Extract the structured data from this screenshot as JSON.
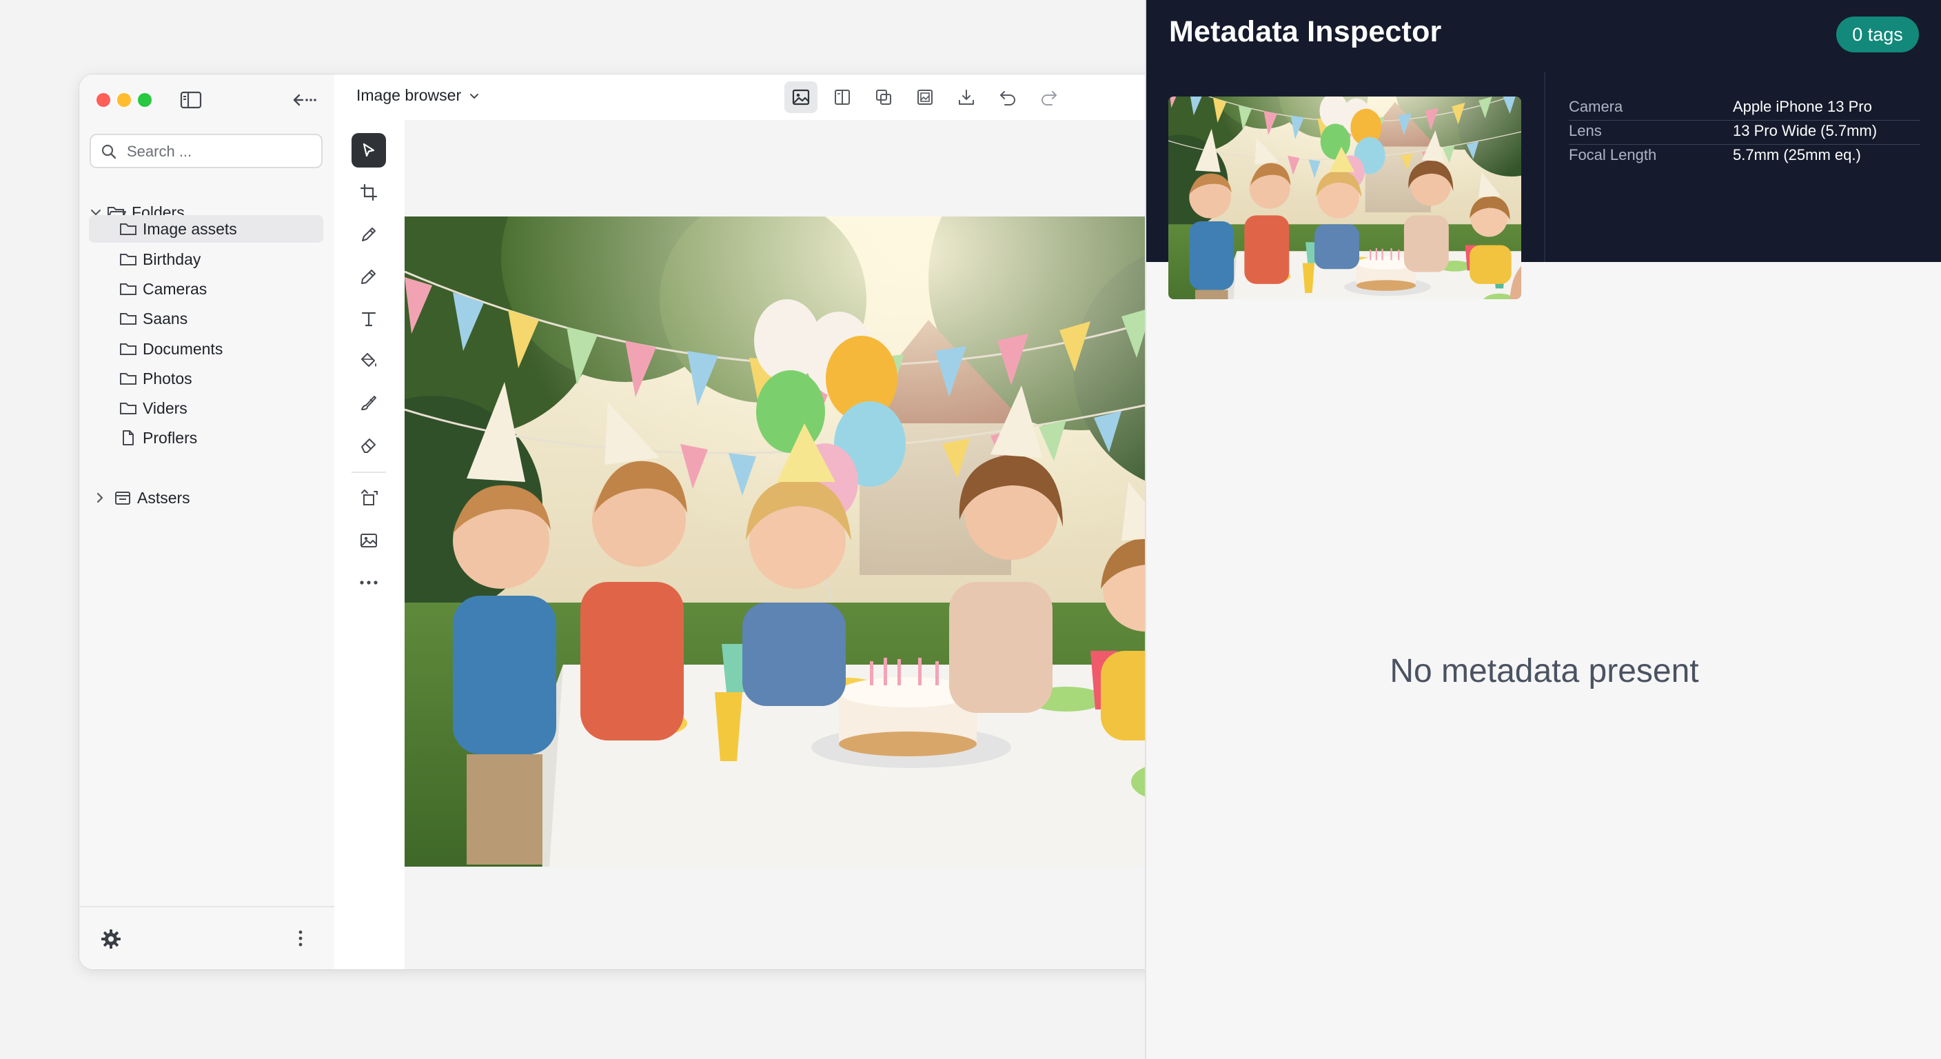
{
  "sidebar": {
    "search_placeholder": "Search ...",
    "folders_label": "Folders",
    "items": [
      {
        "label": "Image assets",
        "icon": "folder-icon",
        "active": true
      },
      {
        "label": "Birthday",
        "icon": "folder-icon"
      },
      {
        "label": "Cameras",
        "icon": "folder-icon"
      },
      {
        "label": "Saans",
        "icon": "folder-icon"
      },
      {
        "label": "Documents",
        "icon": "folder-icon"
      },
      {
        "label": "Photos",
        "icon": "folder-icon"
      },
      {
        "label": "Viders",
        "icon": "folder-icon"
      },
      {
        "label": "Proflers",
        "icon": "file-icon"
      }
    ],
    "second_group_label": "Astsers"
  },
  "toolbar": {
    "title": "Image browser"
  },
  "inspector": {
    "title": "Metadata Inspector",
    "tags_badge": "0 tags",
    "metadata": [
      {
        "key": "Camera",
        "value": "Apple iPhone 13 Pro"
      },
      {
        "key": "Lens",
        "value": "13 Pro Wide (5.7mm)"
      },
      {
        "key": "Focal Length",
        "value": "5.7mm (25mm eq.)"
      }
    ],
    "empty_message": "No metadata present"
  },
  "colors": {
    "inspector_header": "#151b2c",
    "tags_badge": "#12897a",
    "active_tool": "#2f3338"
  }
}
